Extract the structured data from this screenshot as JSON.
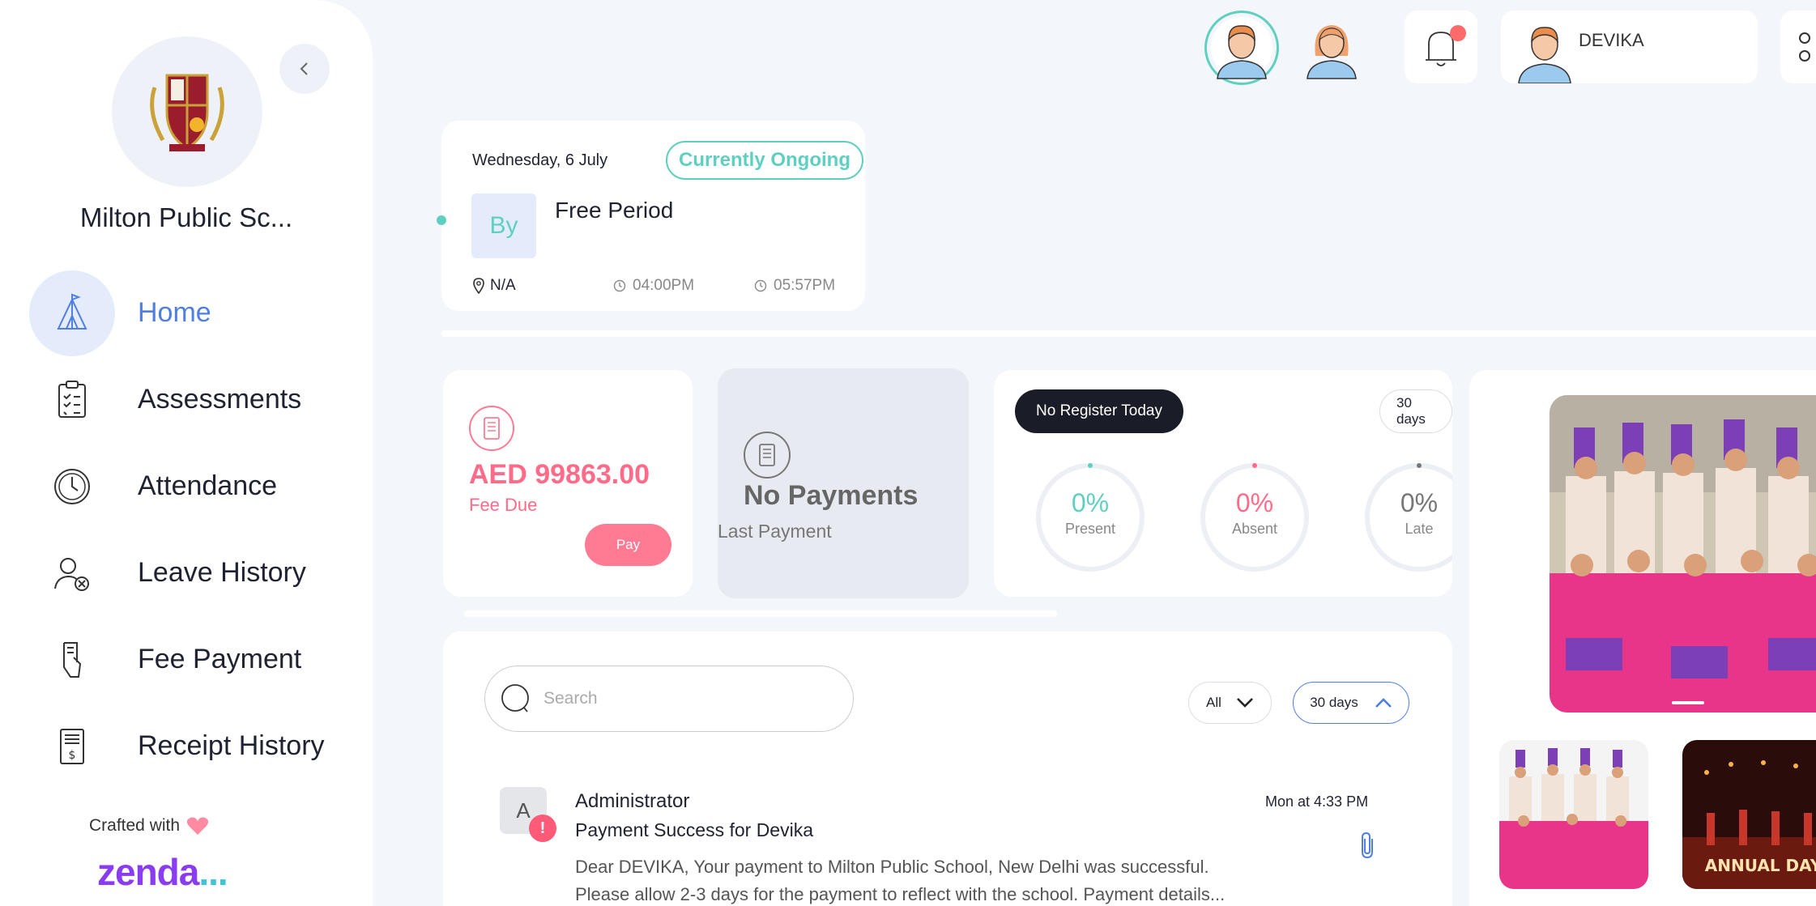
{
  "sidebar": {
    "school_name": "Milton Public Sc...",
    "items": [
      {
        "label": "Home",
        "icon": "tent-icon",
        "active": true
      },
      {
        "label": "Assessments",
        "icon": "clipboard-icon"
      },
      {
        "label": "Attendance",
        "icon": "clock-icon"
      },
      {
        "label": "Leave History",
        "icon": "user-cancel-icon"
      },
      {
        "label": "Fee Payment",
        "icon": "hand-bill-icon"
      },
      {
        "label": "Receipt History",
        "icon": "receipt-icon"
      }
    ],
    "crafted_with": "Crafted with",
    "brand": "zenda",
    "brand_dots": "..."
  },
  "topbar": {
    "user_name": "DEVIKA",
    "notification_badge_color": "#ff6b6b"
  },
  "timetable": {
    "date": "Wednesday, 6 July",
    "status": "Currently Ongoing",
    "initials": "By",
    "title": "Free Period",
    "location": "N/A",
    "start_time": "04:00PM",
    "end_time": "05:57PM"
  },
  "fee": {
    "amount": "AED 99863.00",
    "label": "Fee Due",
    "pay_label": "Pay"
  },
  "payment": {
    "title": "No Payments",
    "subtitle": "Last Payment"
  },
  "attendance": {
    "register_status": "No Register Today",
    "range": "30 days",
    "present_value": "0%",
    "present_label": "Present",
    "absent_value": "0%",
    "absent_label": "Absent",
    "late_value": "0%",
    "late_label": "Late"
  },
  "notifications": {
    "search_placeholder": "Search",
    "filter_type": "All",
    "filter_range": "30 days",
    "message": {
      "avatar_letter": "A",
      "badge": "!",
      "sender": "Administrator",
      "subject": "Payment Success for Devika",
      "time": "Mon at 4:33 PM",
      "body_line1": "Dear DEVIKA, Your payment to Milton Public School, New Delhi was successful.",
      "body_line2": "Please allow 2-3 days for the payment to reflect with the school. Payment details..."
    }
  },
  "gallery": {
    "small_photo_2_caption": "ANNUAL DAY"
  },
  "colors": {
    "accent_blue": "#4f7fe0",
    "teal": "#5fd0c0",
    "pink": "#ff7b93",
    "dark": "#1a1c28"
  }
}
